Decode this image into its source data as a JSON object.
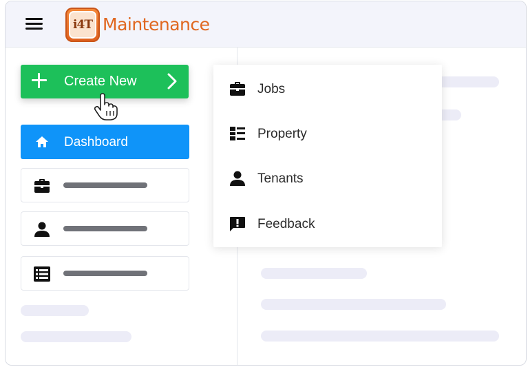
{
  "header": {
    "app_title": "Maintenance",
    "logo_text": "i4T"
  },
  "create_button": {
    "label": "Create New"
  },
  "sidebar": {
    "dashboard_label": "Dashboard",
    "items": [
      {
        "icon": "briefcase-icon"
      },
      {
        "icon": "person-icon"
      },
      {
        "icon": "list-icon"
      }
    ]
  },
  "dropdown": {
    "items": [
      {
        "label": "Jobs",
        "icon": "briefcase-icon"
      },
      {
        "label": "Property",
        "icon": "property-list-icon"
      },
      {
        "label": "Tenants",
        "icon": "person-icon"
      },
      {
        "label": "Feedback",
        "icon": "feedback-icon"
      }
    ]
  },
  "colors": {
    "create_green": "#1dc05a",
    "dashboard_blue": "#0f94f9",
    "brand_orange": "#e0671f"
  }
}
